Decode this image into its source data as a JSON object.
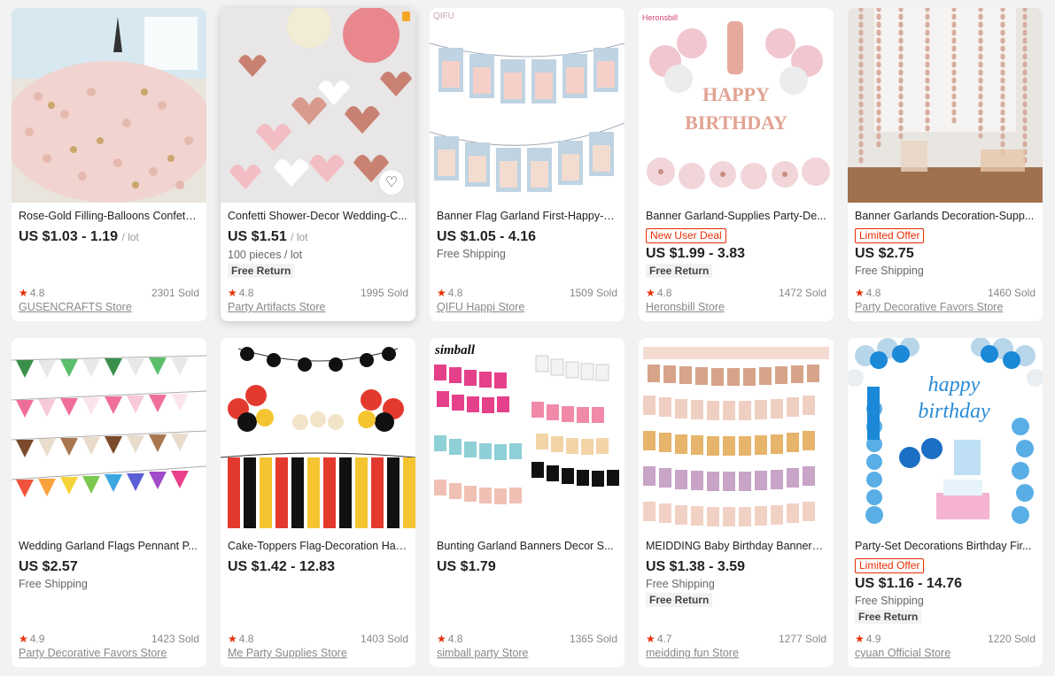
{
  "products": [
    {
      "title": "Rose-Gold Filling-Balloons Confetti...",
      "price": "US $1.03 - 1.19",
      "unit": "/ lot",
      "rating": "4.8",
      "sold": "2301 Sold",
      "store": "GUSENCRAFTS Store",
      "image": "confetti-pile"
    },
    {
      "title": "Confetti Shower-Decor Wedding-C...",
      "price": "US $1.51",
      "unit": "/ lot",
      "sub1": "100 pieces / lot",
      "free_return": "Free Return",
      "rating": "4.8",
      "sold": "1995 Sold",
      "store": "Party Artifacts Store",
      "image": "heart-confetti",
      "favorite_icon": "heart-outline-icon"
    },
    {
      "title": "Banner Flag Garland First-Happy-B...",
      "price": "US $1.05 - 4.16",
      "sub1": "Free Shipping",
      "rating": "4.8",
      "sold": "1509 Sold",
      "store": "QIFU Happi Store",
      "image": "photo-banner",
      "brand_text": "QIFU"
    },
    {
      "title": "Banner Garland-Supplies Party-De...",
      "badge": "New User Deal",
      "price": "US $1.99 - 3.83",
      "free_return": "Free Return",
      "rating": "4.8",
      "sold": "1472 Sold",
      "store": "Heronsbill Store",
      "image": "birthday-balloons",
      "brand_text": "Heronsbill"
    },
    {
      "title": "Banner Garlands Decoration-Supp...",
      "badge": "Limited Offer",
      "price": "US $2.75",
      "sub1": "Free Shipping",
      "rating": "4.8",
      "sold": "1460 Sold",
      "store": "Party Decorative Favors Store",
      "image": "dot-garland"
    },
    {
      "title": "Wedding Garland Flags Pennant P...",
      "price": "US $2.57",
      "sub1": "Free Shipping",
      "rating": "4.9",
      "sold": "1423 Sold",
      "store": "Party Decorative Favors Store",
      "image": "pennant-flags"
    },
    {
      "title": "Cake-Toppers Flag-Decoration Hap...",
      "price": "US $1.42 - 12.83",
      "rating": "4.8",
      "sold": "1403 Sold",
      "store": "Me Party Supplies Store",
      "image": "mickey-party"
    },
    {
      "title": "Bunting Garland Banners Decor S...",
      "price": "US $1.79",
      "rating": "4.8",
      "sold": "1365 Sold",
      "store": "simball party Store",
      "image": "bunting-banners",
      "brand_text": "simball"
    },
    {
      "title": "MEIDDING Baby Birthday Banners ...",
      "price": "US $1.38 - 3.59",
      "sub1": "Free Shipping",
      "free_return": "Free Return",
      "rating": "4.7",
      "sold": "1277 Sold",
      "store": "meidding fun Store",
      "image": "baby-photo-banners"
    },
    {
      "title": "Party-Set Decorations Birthday Fir...",
      "badge": "Limited Offer",
      "price": "US $1.16 - 14.76",
      "sub1": "Free Shipping",
      "free_return": "Free Return",
      "rating": "4.9",
      "sold": "1220 Sold",
      "store": "cyuan Official Store",
      "image": "blue-balloon-arch"
    }
  ],
  "colors": {
    "accent": "#e62e04",
    "badge_border": "#e62e04",
    "background": "#f2f2f2",
    "star": "#e62e04"
  }
}
